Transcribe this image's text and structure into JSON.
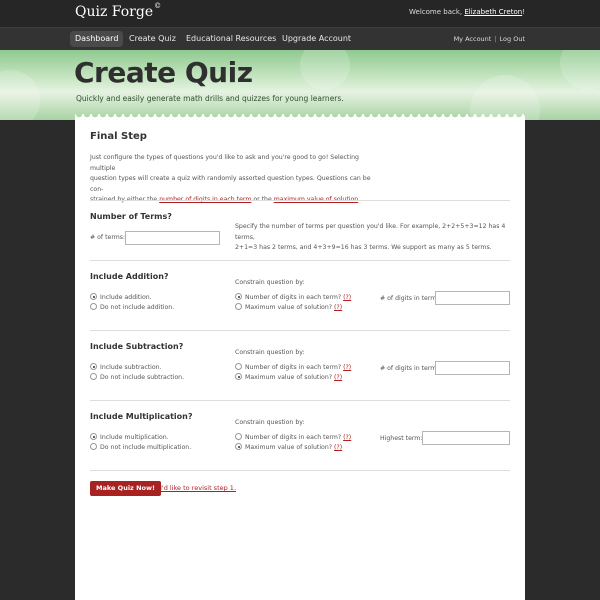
{
  "header": {
    "logo": "Quiz Forge",
    "logo_mark": "©",
    "welcome_prefix": "Welcome back,",
    "user_name": "Elizabeth Creton",
    "welcome_suffix": "!"
  },
  "nav": {
    "items": [
      "Dashboard",
      "Create Quiz",
      "Educational Resources",
      "Upgrade Account"
    ],
    "active": "Dashboard",
    "my_account": "My Account",
    "separator": "|",
    "log_out": "Log Out"
  },
  "banner": {
    "title": "Create Quiz",
    "subtitle": "Quickly and easily generate math drills and quizzes for young learners."
  },
  "final_step": {
    "heading": "Final Step",
    "intro_1": "Just configure the types of questions you'd like to ask and you're good to go! Selecting multiple",
    "intro_2": "question types will create a quiz with randomly assorted question types. Questions can be con-",
    "intro_3_prefix": "strained by either the",
    "intro_link_1": "number of digits in each term",
    "intro_3_mid": "or the",
    "intro_link_2": "maximum value of solution",
    "intro_3_suffix": "."
  },
  "terms": {
    "heading": "Number of Terms?",
    "label": "# of terms:",
    "value": "",
    "help_1": "Specify the number of terms per question you'd like. For example, 2+2+5+3=12 has 4 terms,",
    "help_2": "2+1=3 has 2 terms, and 4+3+9=16 has 3 terms. We support as many as 5 terms."
  },
  "addition": {
    "heading": "Include Addition?",
    "include": "Include addition.",
    "exclude": "Do not include addition.",
    "constrain_label": "Constrain question by:",
    "opt_digits": "Number of digits in each term?",
    "opt_max": "Maximum value of solution?",
    "help_mark": "(?)",
    "right_label": "# of digits in term:",
    "right_value": ""
  },
  "subtraction": {
    "heading": "Include Subtraction?",
    "include": "Include subtraction.",
    "exclude": "Do not include subtraction.",
    "constrain_label": "Constrain question by:",
    "opt_digits": "Number of digits in each term?",
    "opt_max": "Maximum value of solution?",
    "help_mark": "(?)",
    "right_label": "# of digits in term:",
    "right_value": ""
  },
  "multiplication": {
    "heading": "Include Multiplication?",
    "include": "Include multiplication.",
    "exclude": "Do not include multiplication.",
    "constrain_label": "Constrain question by:",
    "opt_digits": "Number of digits in each term?",
    "opt_max": "Maximum value of solution?",
    "help_mark": "(?)",
    "right_label": "Highest term:",
    "right_value": ""
  },
  "actions": {
    "submit": "Make Quiz Now!",
    "revisit": "I'd like to revisit step 1."
  },
  "colors": {
    "accent": "#a82222",
    "link": "#b02020",
    "banner_green": "#c7e6c3"
  }
}
